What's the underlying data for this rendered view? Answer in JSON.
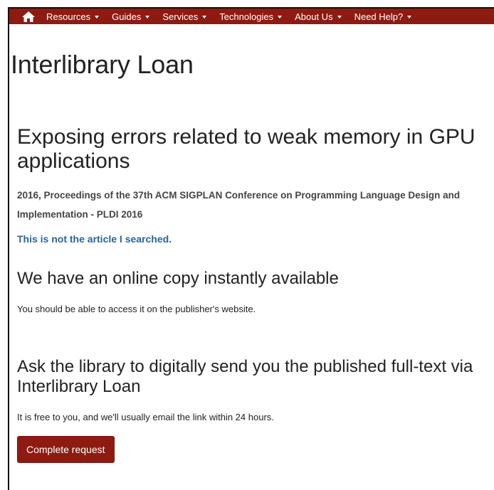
{
  "nav": {
    "home_icon": "home-icon",
    "items": [
      {
        "label": "Resources"
      },
      {
        "label": "Guides"
      },
      {
        "label": "Services"
      },
      {
        "label": "Technologies"
      },
      {
        "label": "About Us"
      },
      {
        "label": "Need Help?"
      }
    ]
  },
  "page": {
    "title": "Interlibrary Loan"
  },
  "article": {
    "title": "Exposing errors related to weak memory in GPU applications",
    "citation": "2016, Proceedings of the 37th ACM SIGPLAN Conference on Programming Language Design and Implementation - PLDI 2016",
    "not_article_link": "This is not the article I searched."
  },
  "online": {
    "heading": "We have an online copy instantly available",
    "text": "You should be able to access it on the publisher's website."
  },
  "ill": {
    "heading": "Ask the library to digitally send you the published full-text via Interlibrary Loan",
    "text": "It is free to you, and we'll usually email the link within 24 hours.",
    "button_label": "Complete request"
  },
  "colors": {
    "brand": "#8d1b12",
    "link": "#2a6496"
  }
}
